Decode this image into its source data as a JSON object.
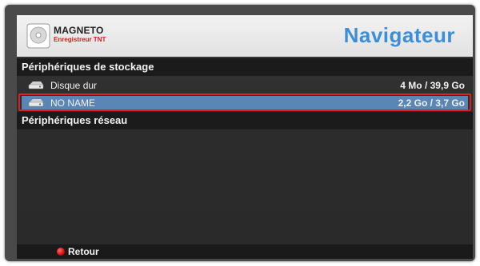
{
  "header": {
    "logo_title": "MAGNETO",
    "logo_subtitle": "Enregistreur TNT",
    "page_title": "Navigateur"
  },
  "sections": [
    {
      "title": "Périphériques de stockage",
      "items": [
        {
          "label": "Disque dur",
          "size": "4 Mo / 39,9 Go",
          "icon": "hard-drive-icon",
          "selected": false
        },
        {
          "label": "NO NAME",
          "size": "2,2 Go / 3,7 Go",
          "icon": "hard-drive-icon",
          "selected": true
        }
      ]
    },
    {
      "title": "Périphériques réseau",
      "items": []
    }
  ],
  "footer": {
    "back_label": "Retour",
    "back_key_color": "#d00000"
  },
  "colors": {
    "title_blue": "#3c8fd6",
    "selection_bg": "#5a86b5",
    "selection_outline": "#e02020"
  }
}
